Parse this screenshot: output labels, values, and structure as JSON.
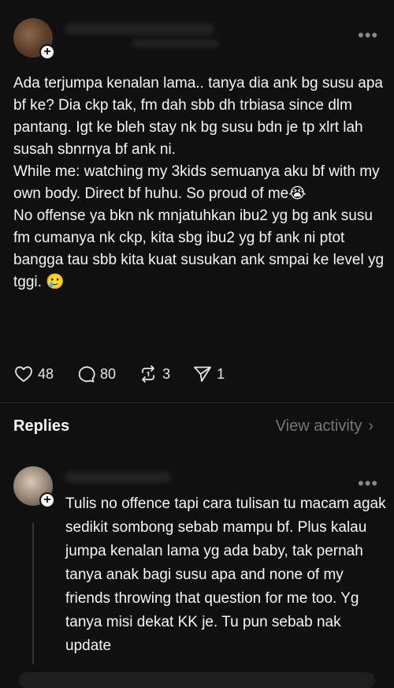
{
  "post": {
    "avatar_icon": "avatar",
    "follow_icon": "plus-icon",
    "more_icon": "more-dots-icon",
    "more_label": "•••",
    "follow_label": "+",
    "lines": [
      "Ada terjumpa kenalan lama.. tanya dia ank bg susu apa bf ke? Dia ckp tak, fm dah sbb dh trbiasa since dlm pantang. Igt ke bleh stay nk bg susu bdn je tp xlrt lah susah sbnrnya bf ank ni.",
      "While me: watching my 3kids semuanya aku bf with my own body. Direct bf huhu.  So proud of me😭",
      "No offense ya bkn nk mnjatuhkan ibu2 yg bg ank susu fm cumanya nk ckp, kita sbg ibu2 yg bf ank ni ptot bangga tau sbb kita kuat susukan ank smpai ke level yg tggi. 🥲"
    ],
    "stats": {
      "likes": "48",
      "comments": "80",
      "reposts": "3",
      "shares": "1"
    }
  },
  "replies_header": {
    "label": "Replies",
    "view_activity": "View activity",
    "chevron": "›"
  },
  "reply": {
    "avatar_icon": "avatar",
    "follow_label": "+",
    "more_label": "•••",
    "text": "Tulis no offence tapi cara tulisan tu macam agak sedikit sombong sebab mampu bf. Plus kalau jumpa kenalan lama yg ada baby, tak pernah tanya anak bagi susu apa and none of my friends throwing that question for me too. Yg tanya misi dekat KK je. Tu pun sebab nak update"
  },
  "colors": {
    "background": "#101010",
    "text": "#f3f5f7",
    "muted": "#777777",
    "divider": "#262626"
  }
}
